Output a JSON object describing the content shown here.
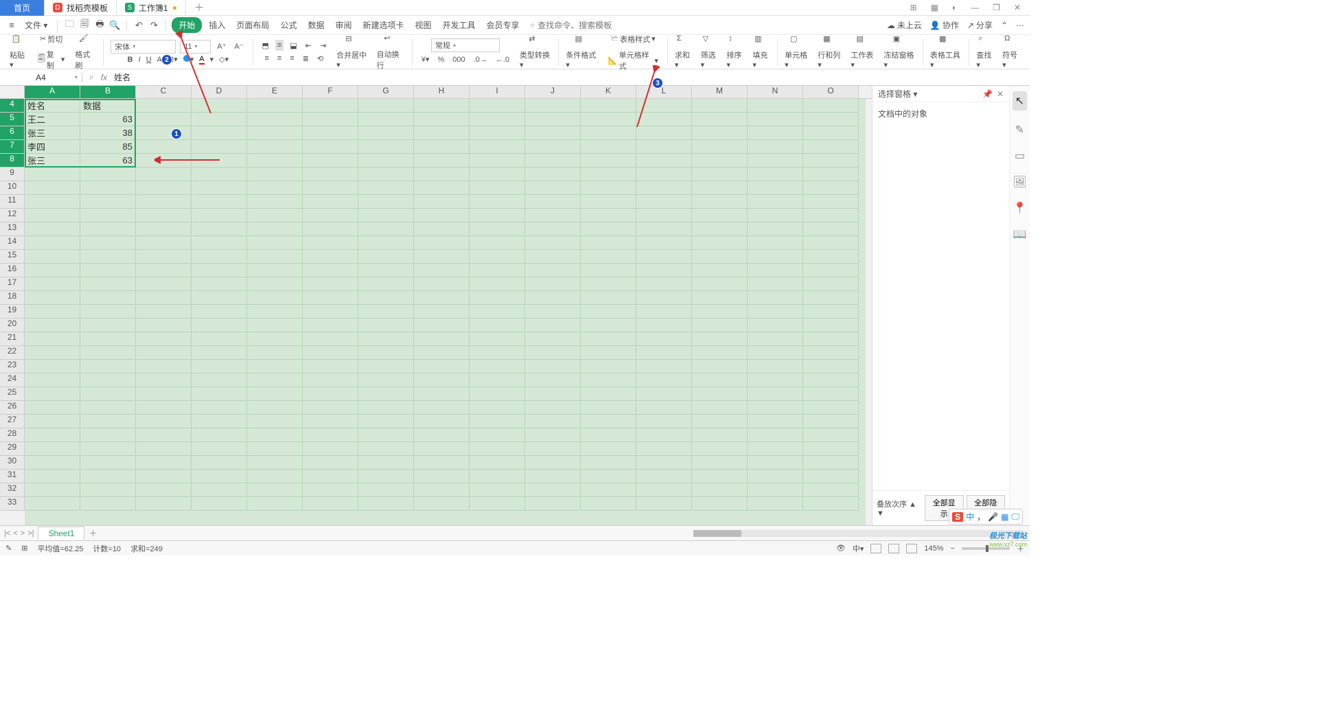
{
  "tabs": {
    "home": "首页",
    "template": "找稻壳模板",
    "workbook": "工作簿1"
  },
  "window": {
    "grid": "▦",
    "apps": "▦",
    "user": "◐",
    "min": "—",
    "max": "❐",
    "close": "✕"
  },
  "file_label": "文件",
  "menu": [
    "开始",
    "插入",
    "页面布局",
    "公式",
    "数据",
    "审阅",
    "新建选项卡",
    "视图",
    "开发工具",
    "会员专享"
  ],
  "search_placeholder": "查找命令、搜索模板",
  "topright": {
    "cloud": "未上云",
    "collab": "协作",
    "share": "分享"
  },
  "ribbon": {
    "paste": "粘贴",
    "cut": "剪切",
    "copy": "复制",
    "format_painter": "格式刷",
    "font_name": "宋体",
    "font_size": "11",
    "merge": "合并居中",
    "wrap": "自动换行",
    "number_format": "常规",
    "type_convert": "类型转换",
    "cond": "条件格式",
    "table_style": "表格样式",
    "cell_style": "单元格样式",
    "sum": "求和",
    "filter": "筛选",
    "sort": "排序",
    "fill": "填充",
    "cell": "单元格",
    "rowcol": "行和列",
    "worksheet": "工作表",
    "freeze": "冻结窗格",
    "table_tools": "表格工具",
    "find": "查找",
    "symbol": "符号"
  },
  "namebox": "A4",
  "formula_value": "姓名",
  "selection_pane": {
    "title": "选择窗格",
    "objects": "文档中的对象",
    "stack": "叠放次序",
    "show_all": "全部显示",
    "hide_all": "全部隐藏"
  },
  "columns": [
    "A",
    "B",
    "C",
    "D",
    "E",
    "F",
    "G",
    "H",
    "I",
    "J",
    "K",
    "L",
    "M",
    "N",
    "O"
  ],
  "rows": [
    "4",
    "5",
    "6",
    "7",
    "8",
    "9",
    "10",
    "11",
    "12",
    "13",
    "14",
    "15",
    "16",
    "17",
    "18",
    "19",
    "20",
    "21",
    "22",
    "23",
    "24",
    "25",
    "26",
    "27",
    "28",
    "29",
    "30",
    "31",
    "32",
    "33"
  ],
  "cells": {
    "r4": {
      "A": "姓名",
      "B": "数据"
    },
    "r5": {
      "A": "王二",
      "B": "63"
    },
    "r6": {
      "A": "张三",
      "B": "38"
    },
    "r7": {
      "A": "李四",
      "B": "85"
    },
    "r8": {
      "A": "张三",
      "B": "63"
    }
  },
  "sheet": {
    "name": "Sheet1"
  },
  "status": {
    "avg": "平均值=62.25",
    "count": "计数=10",
    "sum": "求和=249",
    "zoom": "145%"
  },
  "annot": {
    "n1": "1",
    "n2": "2",
    "n3": "3"
  },
  "watermark": {
    "t1": "极光下载站",
    "t2": "www.xz7.com"
  },
  "ime": {
    "logo": "S",
    "lang": "中",
    "comma": "，",
    "mic": "🎤",
    "grid": "▦",
    "mon": "🖵"
  }
}
